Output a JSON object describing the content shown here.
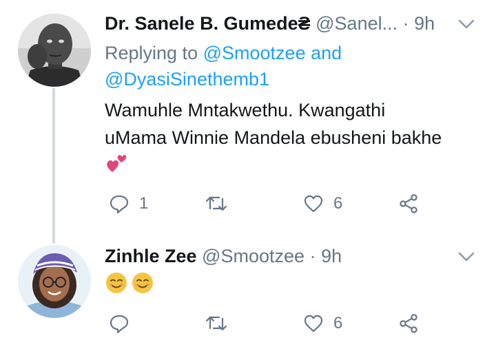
{
  "tweets": [
    {
      "display_name": "Dr. Sanele B. Gumede",
      "name_badge": "₴",
      "handle": "@Sanel...",
      "dot": "·",
      "time": "9h",
      "replying_prefix": "Replying to",
      "mention_1": "@Smootzee",
      "replying_and": "and",
      "mention_2": "@DyasiSinethemb1",
      "body_line_1": "Wamuhle Mntakwethu. Kwangathi",
      "body_line_2": "uMama Winnie Mandela ebusheni bakhe",
      "body_emoji": "💕",
      "reply_count": "1",
      "retweet_count": "",
      "like_count": "6"
    },
    {
      "display_name": "Zinhle Zee",
      "handle": "@Smootzee",
      "dot": "·",
      "time": "9h",
      "body_emoji": "😊😊",
      "reply_count": "",
      "retweet_count": "",
      "like_count": "6"
    }
  ],
  "icons": {
    "reply": "reply-icon",
    "retweet": "retweet-icon",
    "like": "heart-icon",
    "share": "share-icon",
    "caret": "chevron-down-icon"
  },
  "colors": {
    "link": "#1da1f2",
    "secondary_text": "#657786",
    "primary_text": "#14171a",
    "thread_line": "#cfd9de",
    "heart_emoji": "#e0457b",
    "smile_emoji": "#f5c542"
  }
}
